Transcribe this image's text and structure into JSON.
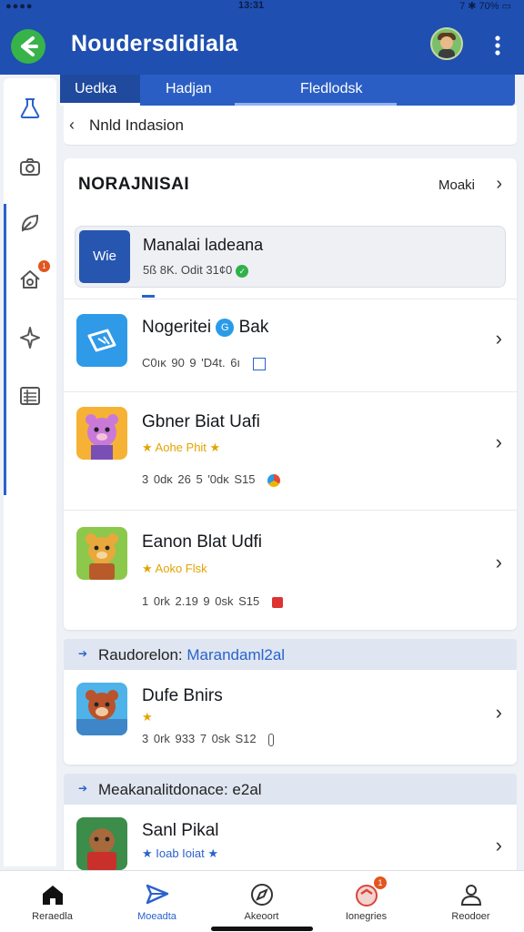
{
  "status_bar": {
    "signal": "●●●●",
    "time": "13:31",
    "right": "7 ✱ 70% ▭"
  },
  "app_bar": {
    "title": "Noudersdidiala",
    "back_icon": "arrow-left-icon",
    "more_icon": "more-vert-icon",
    "accent": "#1f4fb0"
  },
  "tabs": [
    {
      "label": "Uedka",
      "active": true
    },
    {
      "label": "Hadjan",
      "active": false
    },
    {
      "label": "Fledlodsk",
      "active": false
    }
  ],
  "breadcrumb": {
    "label": "Nnld Indasion"
  },
  "sidebar": {
    "icons": [
      "flask-icon",
      "camera-icon",
      "leaf-icon",
      "house-icon",
      "plane-icon",
      "list-icon"
    ],
    "badge": "1"
  },
  "section": {
    "title": "NORAJNISAI",
    "more_label": "Moaki"
  },
  "featured": {
    "logo_text": "Wie",
    "name": "Manalai ladeana",
    "meta": "5ß  8K.  Odit  31¢0"
  },
  "apps": [
    {
      "name": "Nogeritei",
      "tag": "Bak",
      "meta": "C0ıĸ    90    9 'D4t.    6ı"
    },
    {
      "name": "Gbner Biat Uafi",
      "sub": "★ Aohe Phit ★",
      "meta": "3 0dĸ    26    5 '0dĸ    S15"
    },
    {
      "name": "Eanon Blat Udfi",
      "sub": "★ Aoko Flsk",
      "meta": "1 0rk    2.19    9 0sk    S15"
    }
  ],
  "section2": {
    "label": "Raudorelon:",
    "highlight": "Marandaml2al"
  },
  "app4": {
    "name": "Dufe Bnirs",
    "sub": "★",
    "meta": "3 0rk    933    7 0sk    S12"
  },
  "section3": {
    "label": "Meakanalitdonace: e2al"
  },
  "app5": {
    "name": "Sanl Pikal",
    "sub": "★ Ioab Ioiat ★"
  },
  "bottom_nav": [
    {
      "label": "Reraedla",
      "icon": "home-icon",
      "active": false
    },
    {
      "label": "Moeadta",
      "icon": "send-icon",
      "active": true
    },
    {
      "label": "Akeoort",
      "icon": "explore-icon",
      "active": false
    },
    {
      "label": "Ionegries",
      "icon": "notification-icon",
      "active": false,
      "badge": "1"
    },
    {
      "label": "Reodoer",
      "icon": "person-icon",
      "active": false
    }
  ]
}
